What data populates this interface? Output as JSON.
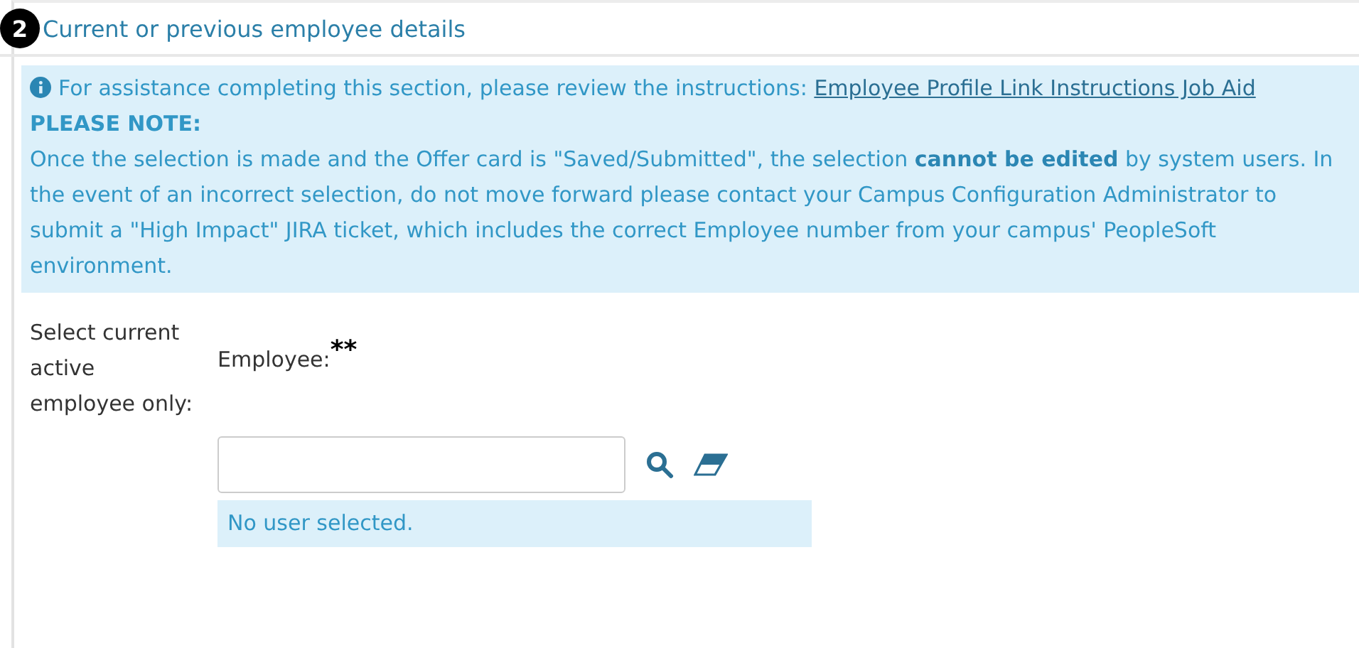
{
  "section": {
    "number": "2",
    "title": "Current or previous employee details"
  },
  "notice": {
    "lead": "For assistance completing this section, please review the instructions:",
    "link": "Employee Profile Link Instructions Job Aid",
    "heading": "PLEASE NOTE:",
    "body": "Once the selection is made and the Offer card is \"Saved/Submitted\", the selection **cannot be edited** by system users. In the event of an incorrect selection, do not move forward please contact your Campus Configuration Administrator to submit a \"High Impact\" JIRA ticket, which includes the correct Employee number from your campus' PeopleSoft environment."
  },
  "form": {
    "instruction": "Select current active employee only:",
    "label": "Employee:",
    "required_mark": "**",
    "status": "No user selected."
  }
}
